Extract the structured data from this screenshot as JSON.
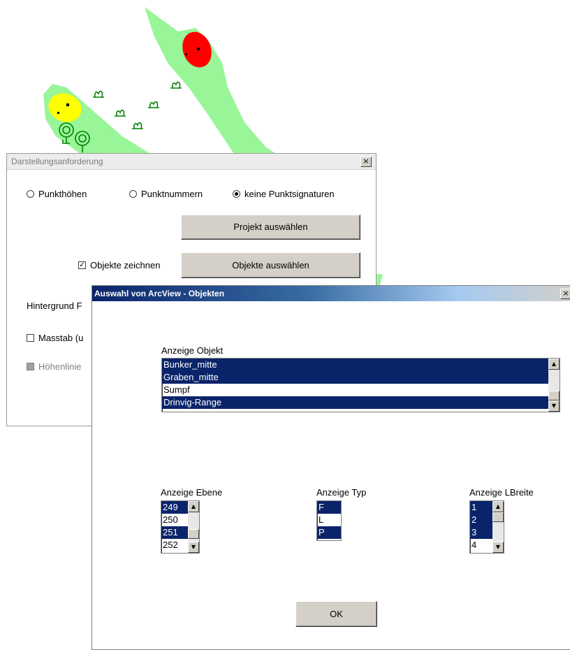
{
  "dialog1": {
    "title": "Darstellungsanforderung",
    "radio_punkthoehen": "Punkthöhen",
    "radio_punktnummern": "Punktnummern",
    "radio_keine": "keine Punktsignaturen",
    "project_button": "Projekt auswählen",
    "objects_checkbox": "Objekte zeichnen",
    "objects_button": "Objekte auswählen",
    "background_label": "Hintergrund F",
    "scale_checkbox": "Masstab (u",
    "contour_checkbox": "Höhenlinie"
  },
  "dialog2": {
    "title": "Auswahl von ArcView - Objekten",
    "object_label": "Anzeige Objekt",
    "objects": [
      "Bunker_mitte",
      "Graben_mitte",
      "Sumpf",
      "Drinvig-Range"
    ],
    "layer_label": "Anzeige Ebene",
    "layers": [
      "249",
      "250",
      "251",
      "252"
    ],
    "type_label": "Anzeige Typ",
    "types": [
      "F",
      "L",
      "P"
    ],
    "width_label": "Anzeige LBreite",
    "widths": [
      "1",
      "2",
      "3",
      "4"
    ],
    "ok_button": "OK"
  },
  "icons": {
    "close": "×",
    "up": "▲",
    "down": "▼",
    "check": "✓"
  },
  "colors": {
    "titlebar_active": "#0a246a",
    "selection": "#0a246a",
    "map_green": "#98f598",
    "map_red": "#ff0000",
    "map_yellow": "#ffff00",
    "map_symbol": "#008000"
  }
}
